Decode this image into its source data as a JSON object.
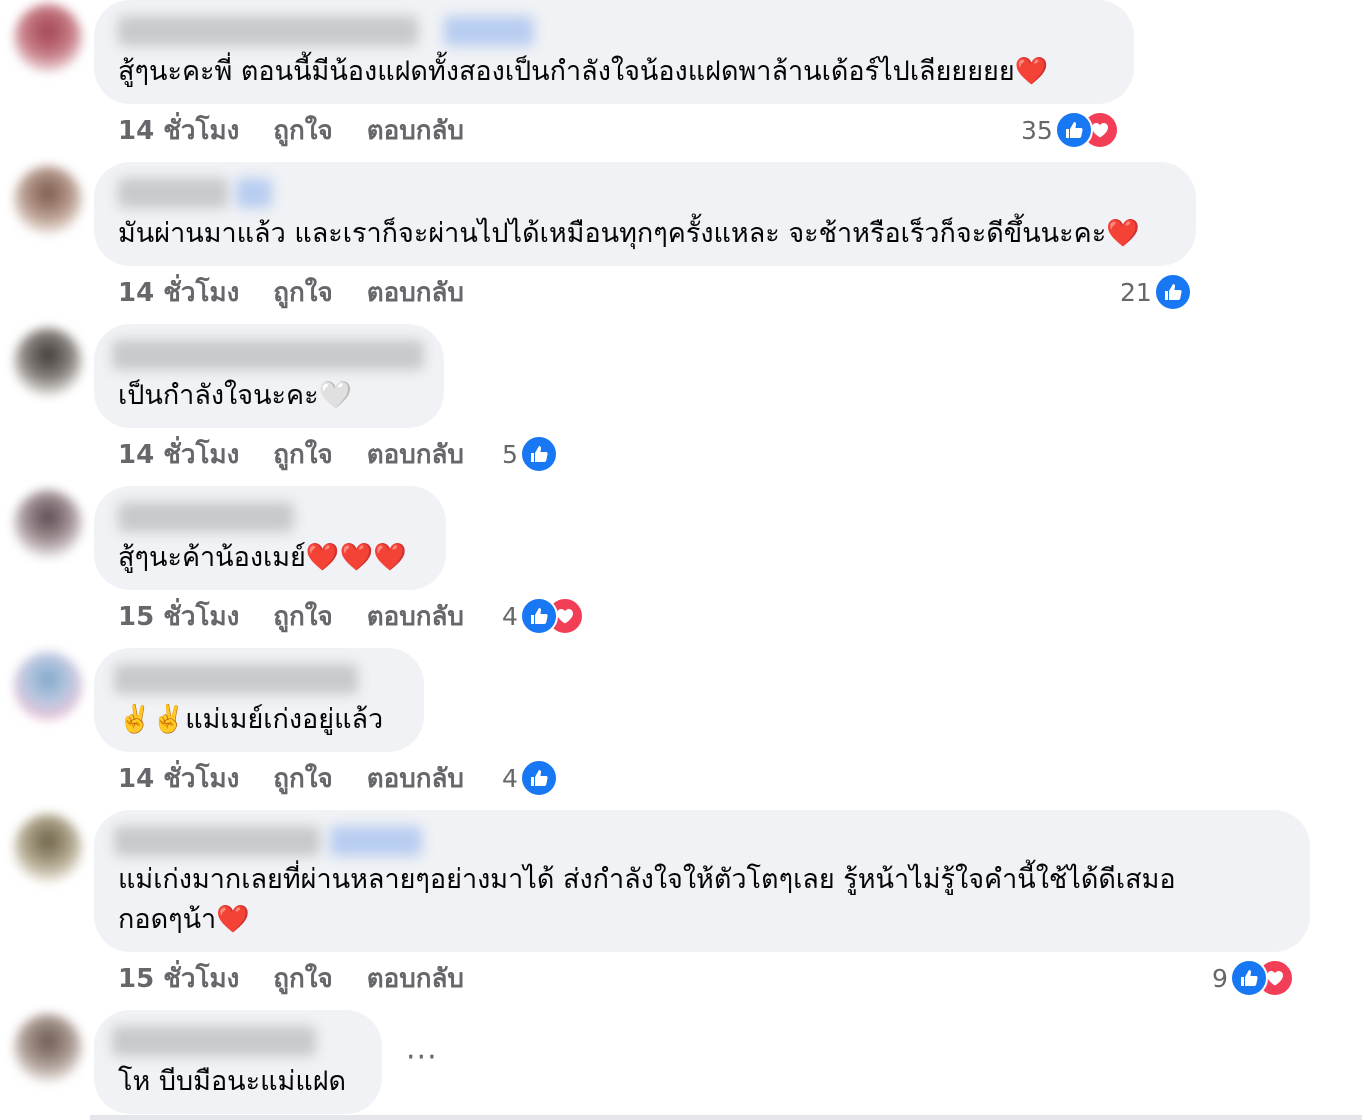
{
  "colors": {
    "bubble_bg": "#f0f2f5",
    "meta_text": "#65676b",
    "like_blue": "#1877f2",
    "love_red": "#f33e58",
    "text": "#050505"
  },
  "meta_labels": {
    "like": "ถูกใจ",
    "reply": "ตอบกลับ"
  },
  "comments": [
    {
      "text": "สู้ๆนะคะพี่ ตอนนี้มีน้องแฝดทั้งสองเป็นกำลังใจน้องแฝดพาล้านเด้อร์ไปเลียยยยย❤️",
      "time": "14 ชั่วโมง",
      "reaction_count": "35",
      "reactions": [
        "like-icon",
        "love-icon"
      ]
    },
    {
      "text": "มันผ่านมาแล้ว และเราก็จะผ่านไปได้เหมือนทุกๆครั้งแหละ จะช้าหรือเร็วก็จะดีขึ้นนะคะ❤️",
      "time": "14 ชั่วโมง",
      "reaction_count": "21",
      "reactions": [
        "like-icon"
      ]
    },
    {
      "text": "เป็นกำลังใจนะคะ🤍",
      "time": "14 ชั่วโมง",
      "reaction_count": "5",
      "reactions": [
        "like-icon"
      ]
    },
    {
      "text": "สู้ๆนะค้าน้องเมย์❤️❤️❤️",
      "time": "15 ชั่วโมง",
      "reaction_count": "4",
      "reactions": [
        "like-icon",
        "love-icon"
      ]
    },
    {
      "text": "✌️✌️แม่เมย์เก่งอยู่แล้ว",
      "time": "14 ชั่วโมง",
      "reaction_count": "4",
      "reactions": [
        "like-icon"
      ]
    },
    {
      "text_line1": "แม่เก่งมากเลยที่ผ่านหลายๆอย่างมาได้ ส่งกำลังใจให้ตัวโตๆเลย รู้หน้าไม่รู้ใจคำนี้ใช้ได้ดีเสมอ",
      "text_line2": "กอดๆน้า❤️",
      "time": "15 ชั่วโมง",
      "reaction_count": "9",
      "reactions": [
        "like-icon",
        "love-icon"
      ]
    },
    {
      "text": "โห บีบมือนะแม่แฝด",
      "more": "···"
    }
  ]
}
